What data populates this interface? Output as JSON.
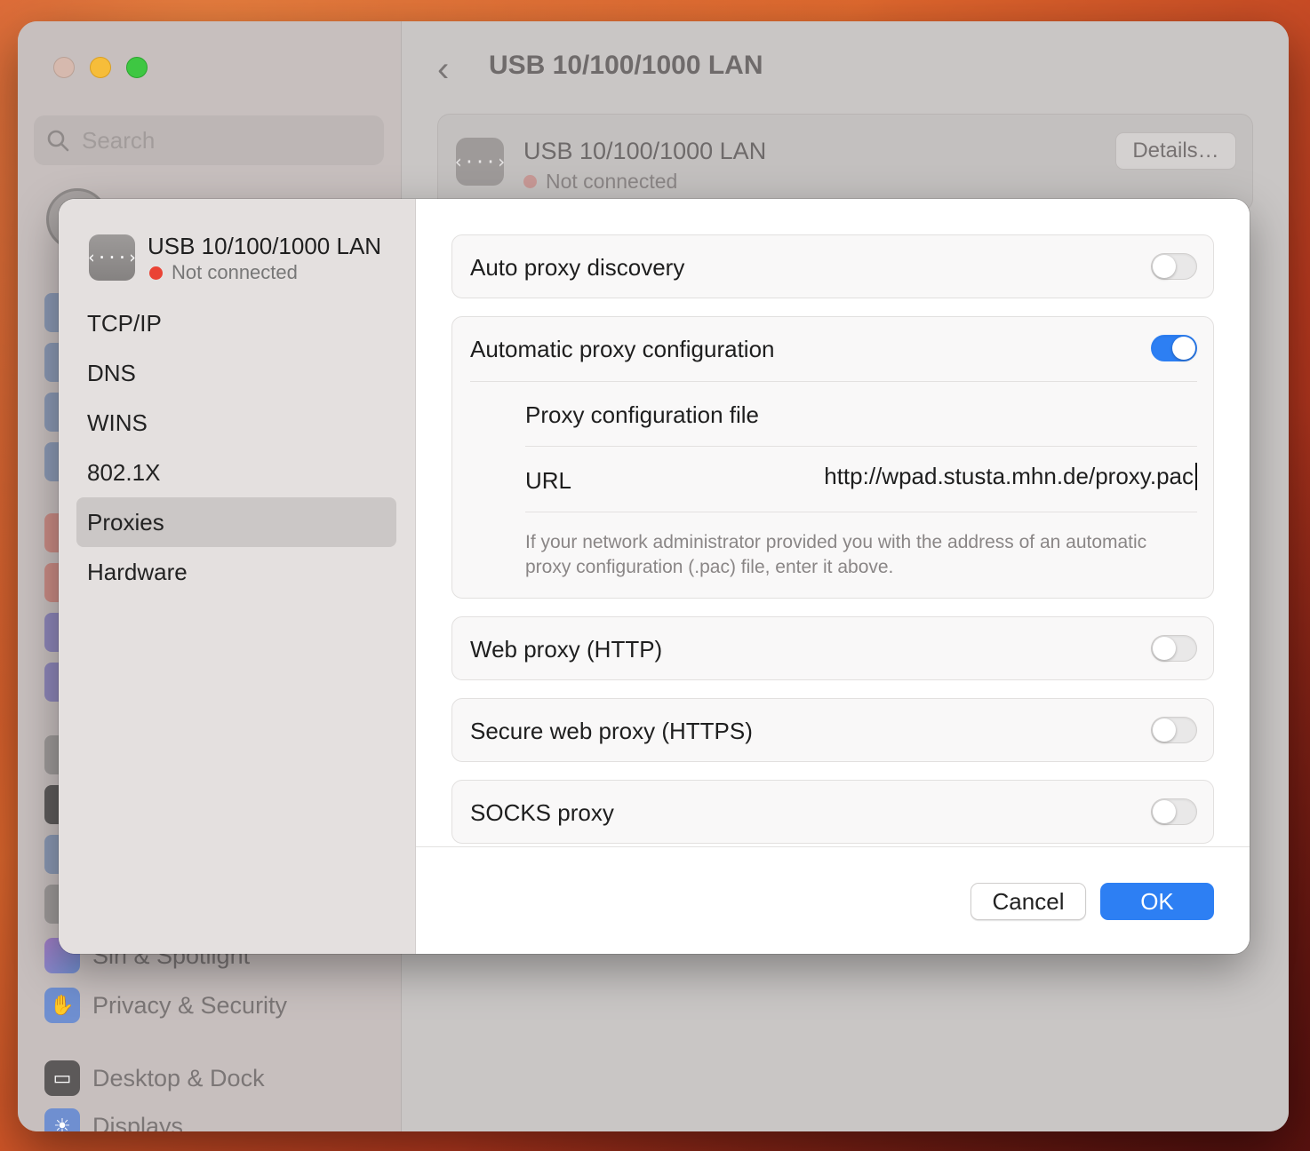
{
  "window": {
    "title": "USB 10/100/1000 LAN",
    "search_placeholder": "Search",
    "sidebar_items": [
      {
        "label": "Siri & Spotlight",
        "icon": "siri-icon"
      },
      {
        "label": "Privacy & Security",
        "icon": "hand-icon"
      },
      {
        "label": "Desktop & Dock",
        "icon": "dock-icon"
      },
      {
        "label": "Displays",
        "icon": "sun-icon"
      }
    ],
    "network_card": {
      "name": "USB 10/100/1000 LAN",
      "status": "Not connected",
      "details_label": "Details…"
    }
  },
  "dialog": {
    "interface": {
      "name": "USB 10/100/1000 LAN",
      "status": "Not connected",
      "icon": "ethernet-icon"
    },
    "nav": [
      "TCP/IP",
      "DNS",
      "WINS",
      "802.1X",
      "Proxies",
      "Hardware"
    ],
    "active_nav": "Proxies",
    "proxies": {
      "auto_discovery": {
        "label": "Auto proxy discovery",
        "enabled": false
      },
      "auto_config": {
        "label": "Automatic proxy configuration",
        "enabled": true,
        "file_label": "Proxy configuration file",
        "url_label": "URL",
        "url_value": "http://wpad.stusta.mhn.de/proxy.pac",
        "help": "If your network administrator provided you with the address of an automatic proxy configuration (.pac) file, enter it above."
      },
      "web": {
        "label": "Web proxy (HTTP)",
        "enabled": false
      },
      "secure_web": {
        "label": "Secure web proxy (HTTPS)",
        "enabled": false
      },
      "socks": {
        "label": "SOCKS proxy",
        "enabled": false
      }
    },
    "buttons": {
      "cancel": "Cancel",
      "ok": "OK"
    },
    "colors": {
      "accent": "#2d7ff3",
      "status_red": "#ea4335"
    }
  }
}
